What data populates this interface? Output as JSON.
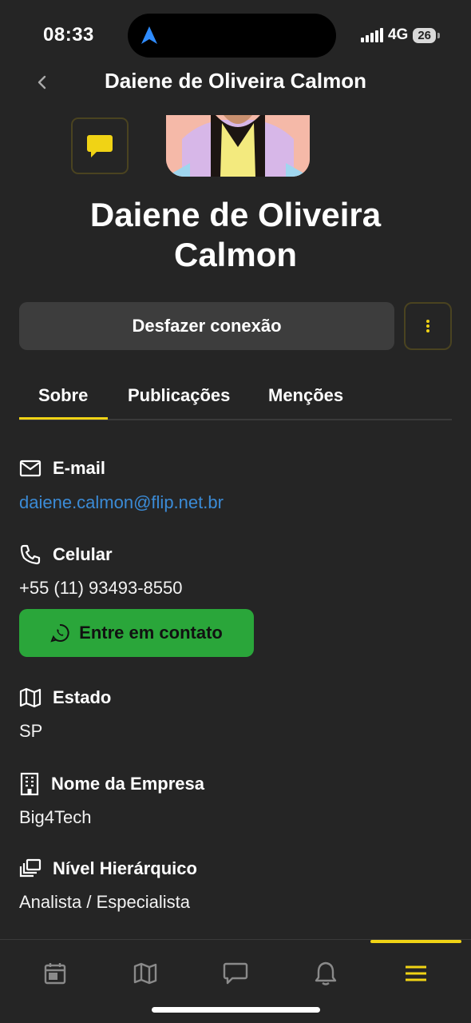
{
  "status": {
    "time": "08:33",
    "network": "4G",
    "battery": "26"
  },
  "header": {
    "title": "Daiene de Oliveira Calmon"
  },
  "profile": {
    "name": "Daiene de Oliveira Calmon"
  },
  "actions": {
    "disconnect_label": "Desfazer conexão"
  },
  "tabs": [
    {
      "label": "Sobre",
      "active": true
    },
    {
      "label": "Publicações",
      "active": false
    },
    {
      "label": "Menções",
      "active": false
    }
  ],
  "fields": {
    "email": {
      "label": "E-mail",
      "value": "daiene.calmon@flip.net.br",
      "icon": "mail-icon"
    },
    "phone": {
      "label": "Celular",
      "value": "+55 (11) 93493-8550",
      "icon": "phone-icon"
    },
    "state": {
      "label": "Estado",
      "value": "SP",
      "icon": "map-icon"
    },
    "company": {
      "label": "Nome da Empresa",
      "value": "Big4Tech",
      "icon": "building-icon"
    },
    "level": {
      "label": "Nível Hierárquico",
      "value": "Analista / Especialista",
      "icon": "layers-icon"
    }
  },
  "contact_button": {
    "label": "Entre em contato",
    "icon": "whatsapp-icon"
  },
  "bottom_nav": [
    {
      "icon": "calendar-icon",
      "active": false
    },
    {
      "icon": "map-icon",
      "active": false
    },
    {
      "icon": "chat-icon",
      "active": false
    },
    {
      "icon": "bell-icon",
      "active": false
    },
    {
      "icon": "menu-icon",
      "active": true
    }
  ],
  "colors": {
    "background": "#252525",
    "accent": "#f0d315",
    "link": "#3b8bd6",
    "whatsapp_green": "#2aa63a",
    "button_gray": "#3d3d3d"
  }
}
